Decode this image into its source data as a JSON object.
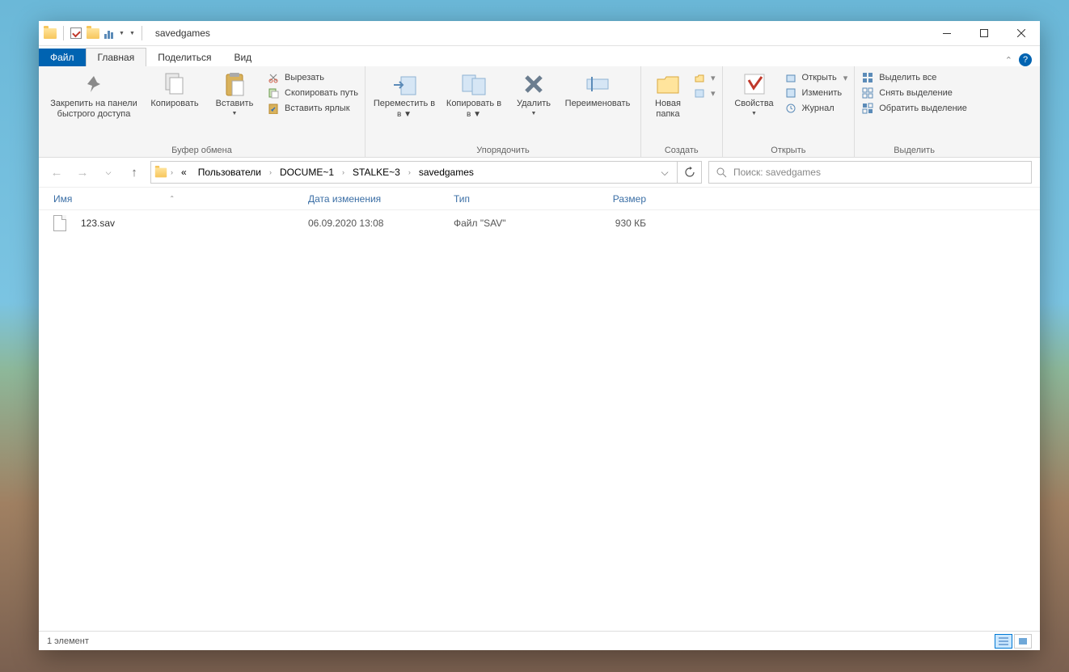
{
  "title": "savedgames",
  "tabs": {
    "file": "Файл",
    "home": "Главная",
    "share": "Поделиться",
    "view": "Вид"
  },
  "ribbon": {
    "clipboard": {
      "pin": "Закрепить на панели\nбыстрого доступа",
      "copy": "Копировать",
      "paste": "Вставить",
      "cut": "Вырезать",
      "copypath": "Скопировать путь",
      "pasteshortcut": "Вставить ярлык",
      "label": "Буфер обмена"
    },
    "organize": {
      "moveto": "Переместить в",
      "copyto": "Копировать в",
      "delete": "Удалить",
      "rename": "Переименовать",
      "label": "Упорядочить"
    },
    "new": {
      "newfolder": "Новая папка",
      "label": "Создать"
    },
    "open": {
      "properties": "Свойства",
      "open": "Открыть",
      "edit": "Изменить",
      "history": "Журнал",
      "label": "Открыть"
    },
    "select": {
      "all": "Выделить все",
      "none": "Снять выделение",
      "invert": "Обратить выделение",
      "label": "Выделить"
    }
  },
  "breadcrumb": {
    "items": [
      "Пользователи",
      "DOCUME~1",
      "STALKE~3",
      "savedgames"
    ],
    "prefix": "«"
  },
  "search": {
    "placeholder": "Поиск: savedgames"
  },
  "columns": {
    "name": "Имя",
    "date": "Дата изменения",
    "type": "Тип",
    "size": "Размер"
  },
  "files": [
    {
      "name": "123.sav",
      "date": "06.09.2020 13:08",
      "type": "Файл \"SAV\"",
      "size": "930 КБ"
    }
  ],
  "status": "1 элемент"
}
